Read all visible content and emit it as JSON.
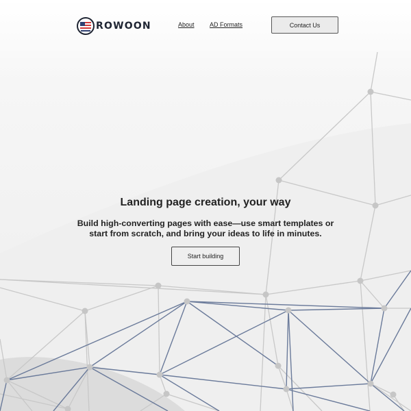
{
  "header": {
    "brand": "ROWOON",
    "nav": [
      {
        "label": "About"
      },
      {
        "label": "AD Formats"
      }
    ],
    "contact_label": "Contact Us"
  },
  "hero": {
    "title": "Landing page creation, your way",
    "subtitle": "Build high-converting pages with ease—use smart templates or start from scratch, and bring your ideas to life in minutes.",
    "cta_label": "Start building"
  },
  "colors": {
    "gray_lines": "#c8c8c8",
    "blue_lines": "#6a7a9a",
    "logo_red": "#d23a3a",
    "logo_blue": "#2e4070",
    "logo_navy": "#1f2533"
  }
}
